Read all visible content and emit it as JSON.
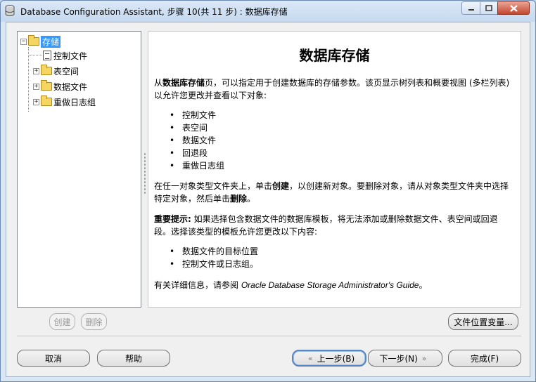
{
  "window": {
    "title": "Database Configuration Assistant, 步骤 10(共 11 步) : 数据库存储"
  },
  "tree": {
    "root": {
      "label": "存储",
      "expander": "−"
    },
    "items": [
      {
        "label": "控制文件",
        "icon": "control-file-icon"
      },
      {
        "label": "表空间",
        "expander": "+"
      },
      {
        "label": "数据文件",
        "expander": "+"
      },
      {
        "label": "重做日志组",
        "expander": "+"
      }
    ]
  },
  "description": {
    "title": "数据库存储",
    "p1_prefix": "从",
    "p1_bold": "数据库存储",
    "p1_line1_rest": "页，可以指定用于创建数据库的存储参数。该页显示树列表和概要视图 (多栏列表)",
    "p1_line2": "以允许您更改并查看以下对象:",
    "list1": [
      "控制文件",
      "表空间",
      "数据文件",
      "回退段",
      "重做日志组"
    ],
    "p2_prefix": "在任一对象类型文件夹上，单击",
    "p2_bold1": "创建",
    "p2_mid": "，以创建新对象。要删除对象，请从对象类型文件夹中选择",
    "p2_line2_prefix": "特定对象，然后单击",
    "p2_bold2": "删除",
    "p2_end": "。",
    "p3_bold": "重要提示:",
    "p3_line1_rest": " 如果选择包含数据文件的数据库模板，将无法添加或删除数据文件、表空间或回退",
    "p3_line2": "段。选择该类型的模板允许您更改以下内容:",
    "list2": [
      "数据文件的目标位置",
      "控制文件或日志组。"
    ],
    "p4_prefix": "有关详细信息，请参阅 ",
    "p4_italic": "Oracle Database Storage Administrator's Guide",
    "p4_end": "。",
    "bullet": "•"
  },
  "buttons": {
    "create": "创建",
    "delete": "删除",
    "file_location_vars": "文件位置变量...",
    "cancel": "取消",
    "help": "帮助",
    "back": "上一步(B)",
    "next": "下一步(N)",
    "finish": "完成(F)",
    "back_arrow": "«",
    "next_arrow": "»"
  }
}
